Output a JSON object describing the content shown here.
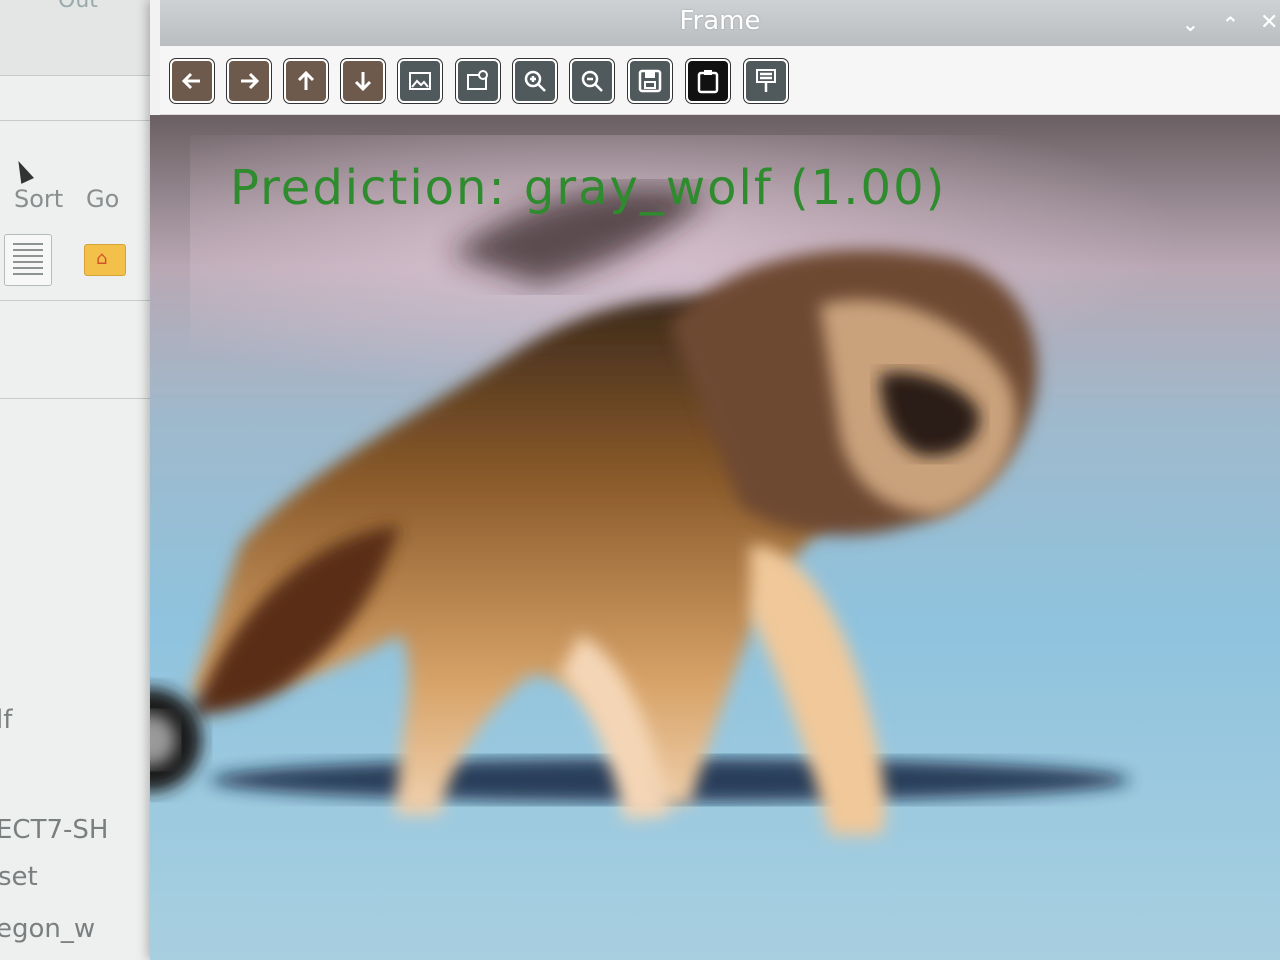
{
  "file_manager": {
    "top_text": "Out",
    "menu": [
      "Sort",
      "Go"
    ],
    "files": [
      "lf",
      "ECT7-SH",
      "set",
      "egon_w"
    ]
  },
  "frame_window": {
    "title": "Frame",
    "window_controls": [
      "chevron-down-icon",
      "chevron-up-icon",
      "close-icon"
    ],
    "toolbar": [
      {
        "icon": "arrow-left-icon"
      },
      {
        "icon": "arrow-right-icon"
      },
      {
        "icon": "arrow-up-icon"
      },
      {
        "icon": "arrow-down-icon"
      },
      {
        "icon": "image-icon"
      },
      {
        "icon": "image-settings-icon"
      },
      {
        "icon": "zoom-in-icon"
      },
      {
        "icon": "zoom-out-icon"
      },
      {
        "icon": "save-icon"
      },
      {
        "icon": "clipboard-icon"
      },
      {
        "icon": "properties-icon"
      }
    ],
    "prediction_text": "Prediction: gray_wolf (1.00)"
  },
  "colors": {
    "prediction_text": "#2e8b2e",
    "toolbar_button": "#111111"
  }
}
